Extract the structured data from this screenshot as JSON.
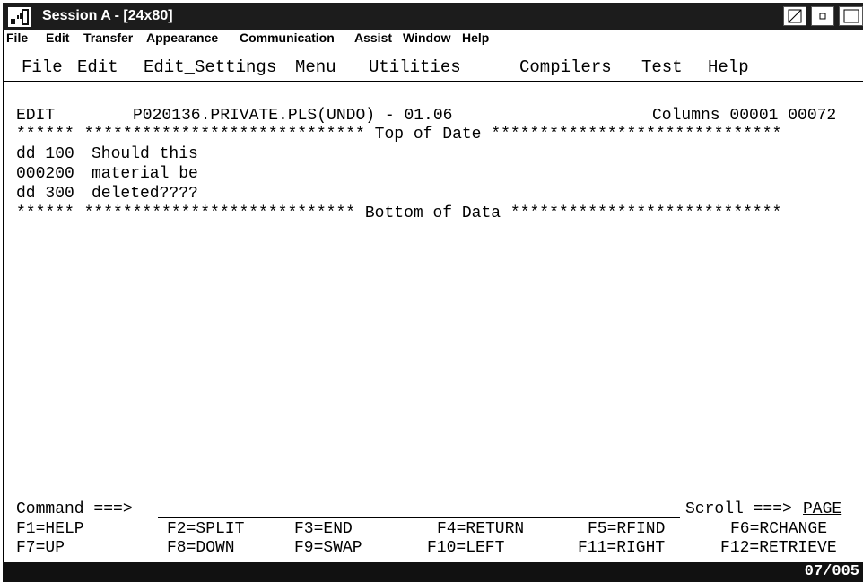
{
  "window": {
    "title": "Session A - [24x80]"
  },
  "app_menubar": [
    {
      "label": "File"
    },
    {
      "label": "Edit"
    },
    {
      "label": "Transfer"
    },
    {
      "label": "Appearance"
    },
    {
      "label": "Communication"
    },
    {
      "label": "Assist"
    },
    {
      "label": "Window"
    },
    {
      "label": "Help"
    }
  ],
  "ispf_menu": [
    {
      "label": "File"
    },
    {
      "label": "Edit"
    },
    {
      "label": "Edit_Settings"
    },
    {
      "label": "Menu"
    },
    {
      "label": "Utilities"
    },
    {
      "label": "Compilers"
    },
    {
      "label": "Test"
    },
    {
      "label": "Help"
    }
  ],
  "editor": {
    "mode": "EDIT",
    "dataset": "P020136.PRIVATE.PLS(UNDO) - 01.06",
    "columns": "Columns 00001 00072",
    "top_line": "****** ***************************** Top of Date ******************************",
    "lines": [
      {
        "prefix": "dd 100",
        "text": "Should this"
      },
      {
        "prefix": "000200",
        "text": "material be"
      },
      {
        "prefix": "dd 300",
        "text": "deleted????"
      }
    ],
    "bottom_line": "****** **************************** Bottom of Data ****************************"
  },
  "command": {
    "label": "Command ===>",
    "value": "",
    "scroll_label": "Scroll ===>",
    "scroll_value": "PAGE"
  },
  "function_keys": [
    [
      "F1=HELP",
      "F2=SPLIT",
      "F3=END",
      "F4=RETURN",
      "F5=RFIND",
      "F6=RCHANGE"
    ],
    [
      "F7=UP",
      "F8=DOWN",
      "F9=SWAP",
      "F10=LEFT",
      "F11=RIGHT",
      "F12=RETRIEVE"
    ]
  ],
  "status": {
    "cursor_pos": "07/005"
  }
}
